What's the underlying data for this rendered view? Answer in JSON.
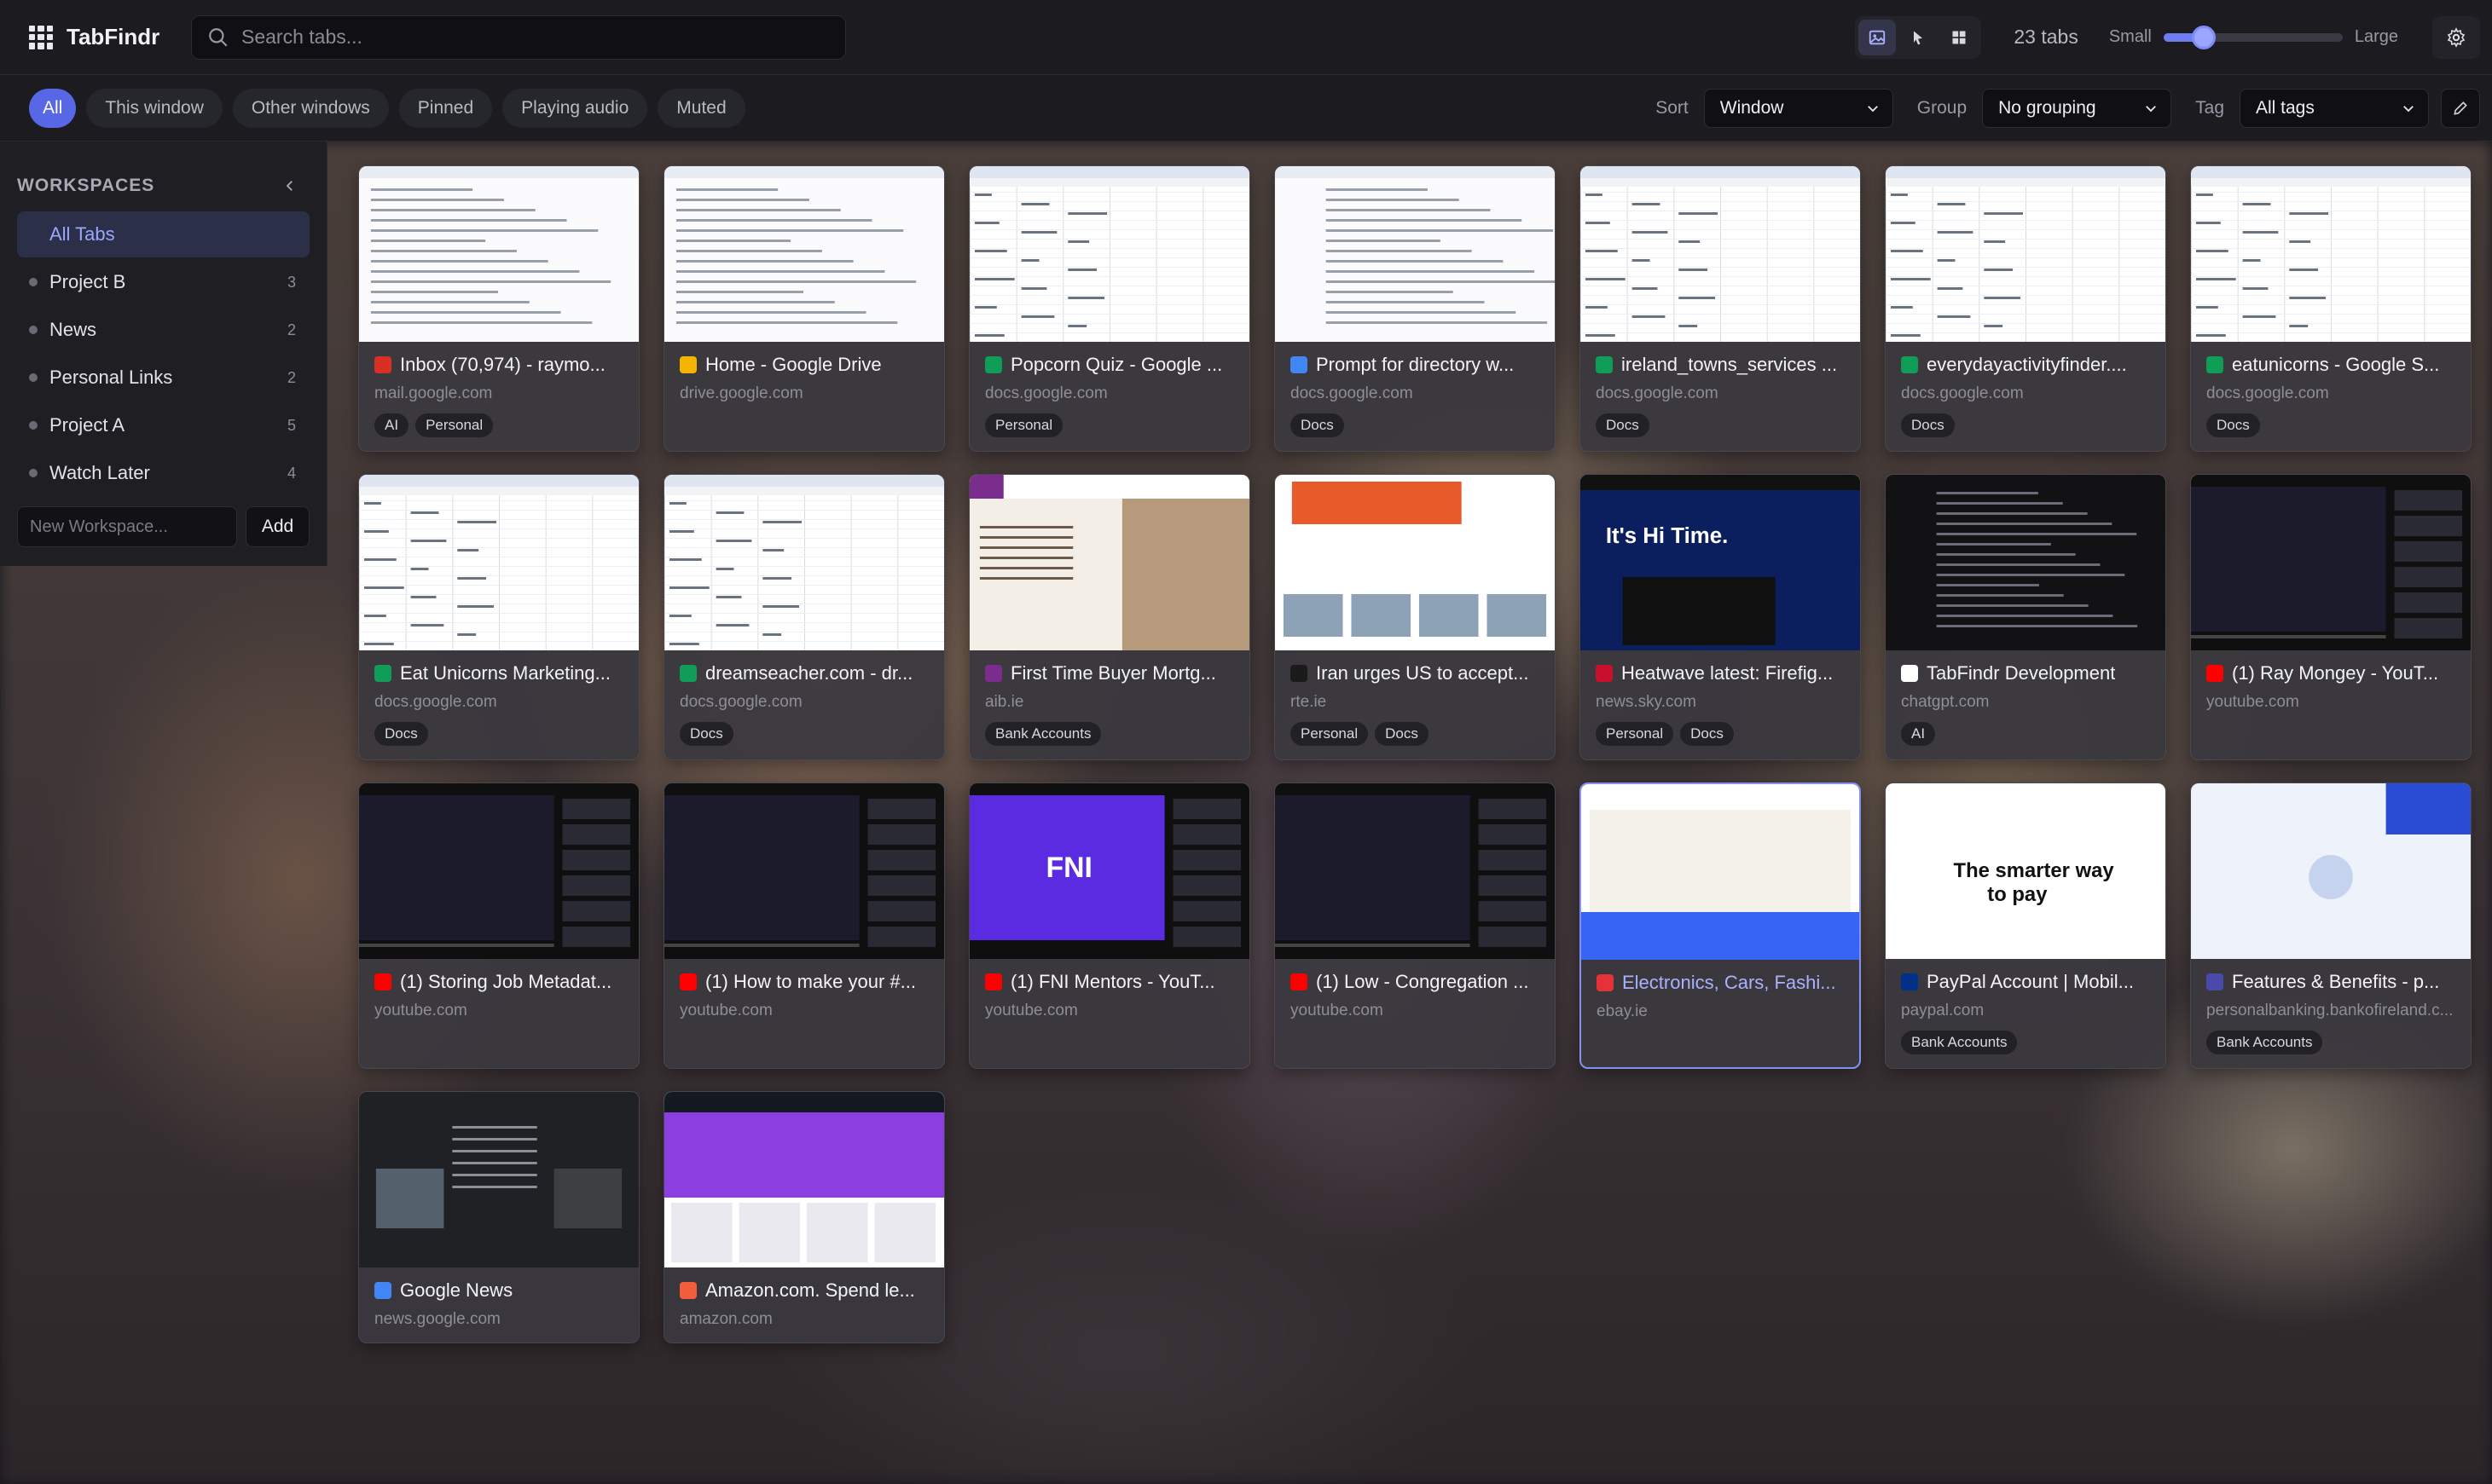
{
  "app": {
    "name": "TabFindr",
    "search_placeholder": "Search tabs...",
    "tab_count": "23 tabs",
    "size_small": "Small",
    "size_large": "Large",
    "thumbnail_size_level": 0.18,
    "accent_color": "#5867e6"
  },
  "filters": {
    "pills": [
      "All",
      "This window",
      "Other windows",
      "Pinned",
      "Playing audio",
      "Muted"
    ],
    "active_pill": "All",
    "sort_label": "Sort",
    "sort_value": "Window",
    "group_label": "Group",
    "group_value": "No grouping",
    "tag_label": "Tag",
    "tag_value": "All tags"
  },
  "sidebar": {
    "title": "WORKSPACES",
    "items": [
      {
        "label": "All Tabs",
        "count": ""
      },
      {
        "label": "Project B",
        "count": "3"
      },
      {
        "label": "News",
        "count": "2"
      },
      {
        "label": "Personal Links",
        "count": "2"
      },
      {
        "label": "Project A",
        "count": "5"
      },
      {
        "label": "Watch Later",
        "count": "4"
      }
    ],
    "new_placeholder": "New Workspace...",
    "add_label": "Add"
  },
  "tabs": [
    {
      "title": "Inbox (70,974) - raymo...",
      "url": "mail.google.com",
      "tags": [
        "AI",
        "Personal"
      ],
      "fav": "#d93025",
      "thumb": "light"
    },
    {
      "title": "Home - Google Drive",
      "url": "drive.google.com",
      "tags": [],
      "fav": "#f4b400",
      "thumb": "light"
    },
    {
      "title": "Popcorn Quiz - Google ...",
      "url": "docs.google.com",
      "tags": [
        "Personal"
      ],
      "fav": "#0f9d58",
      "thumb": "sheet"
    },
    {
      "title": "Prompt for directory w...",
      "url": "docs.google.com",
      "tags": [
        "Docs"
      ],
      "fav": "#4285f4",
      "thumb": "doc"
    },
    {
      "title": "ireland_towns_services ...",
      "url": "docs.google.com",
      "tags": [
        "Docs"
      ],
      "fav": "#0f9d58",
      "thumb": "sheet"
    },
    {
      "title": "everydayactivityfinder....",
      "url": "docs.google.com",
      "tags": [
        "Docs"
      ],
      "fav": "#0f9d58",
      "thumb": "sheet"
    },
    {
      "title": "eatunicorns - Google S...",
      "url": "docs.google.com",
      "tags": [
        "Docs"
      ],
      "fav": "#0f9d58",
      "thumb": "sheet"
    },
    {
      "title": "Eat Unicorns Marketing...",
      "url": "docs.google.com",
      "tags": [
        "Docs"
      ],
      "fav": "#0f9d58",
      "thumb": "sheet"
    },
    {
      "title": "dreamseacher.com - dr...",
      "url": "docs.google.com",
      "tags": [
        "Docs"
      ],
      "fav": "#0f9d58",
      "thumb": "sheet"
    },
    {
      "title": "First Time Buyer Mortg...",
      "url": "aib.ie",
      "tags": [
        "Bank Accounts"
      ],
      "fav": "#7b2d8e",
      "thumb": "aib"
    },
    {
      "title": "Iran urges US to accept...",
      "url": "rte.ie",
      "tags": [
        "Personal",
        "Docs"
      ],
      "fav": "#1a1a1a",
      "thumb": "news"
    },
    {
      "title": "Heatwave latest: Firefig...",
      "url": "news.sky.com",
      "tags": [
        "Personal",
        "Docs"
      ],
      "fav": "#c8102e",
      "thumb": "sky"
    },
    {
      "title": "TabFindr Development",
      "url": "chatgpt.com",
      "tags": [
        "AI"
      ],
      "fav": "#ffffff",
      "thumb": "dark"
    },
    {
      "title": "(1) Ray Mongey - YouT...",
      "url": "youtube.com",
      "tags": [],
      "fav": "#ff0000",
      "thumb": "yt"
    },
    {
      "title": "(1) Storing Job Metadat...",
      "url": "youtube.com",
      "tags": [],
      "fav": "#ff0000",
      "thumb": "yt"
    },
    {
      "title": "(1) How to make your #...",
      "url": "youtube.com",
      "tags": [],
      "fav": "#ff0000",
      "thumb": "yt"
    },
    {
      "title": "(1) FNI Mentors - YouT...",
      "url": "youtube.com",
      "tags": [],
      "fav": "#ff0000",
      "thumb": "fni"
    },
    {
      "title": "(1) Low - Congregation ...",
      "url": "youtube.com",
      "tags": [],
      "fav": "#ff0000",
      "thumb": "yt"
    },
    {
      "title": "Electronics, Cars, Fashi...",
      "url": "ebay.ie",
      "tags": [],
      "fav": "#e53238",
      "thumb": "ebay",
      "selected": true
    },
    {
      "title": "PayPal Account | Mobil...",
      "url": "paypal.com",
      "tags": [
        "Bank Accounts"
      ],
      "fav": "#003087",
      "thumb": "paypal"
    },
    {
      "title": "Features & Benefits - p...",
      "url": "personalbanking.bankofireland.c...",
      "tags": [
        "Bank Accounts"
      ],
      "fav": "#4a4aa8",
      "thumb": "boi"
    },
    {
      "title": "Google News",
      "url": "news.google.com",
      "tags": [],
      "fav": "#4285f4",
      "thumb": "gnews"
    },
    {
      "title": "Amazon.com. Spend le...",
      "url": "amazon.com",
      "tags": [],
      "fav": "#f25e3c",
      "thumb": "amazon"
    }
  ]
}
